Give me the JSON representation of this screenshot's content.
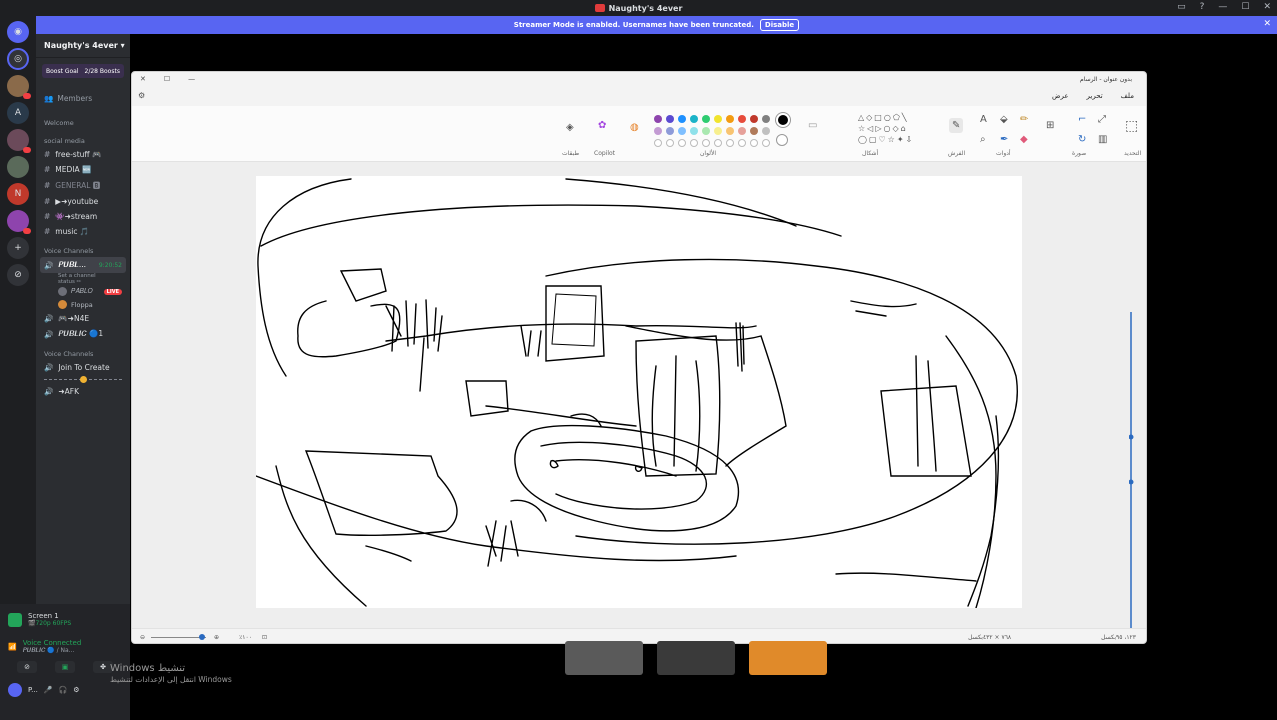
{
  "window": {
    "title": "Naughty's 4ever"
  },
  "banner": {
    "text": "Streamer Mode is enabled. Usernames have been truncated.",
    "button": "Disable"
  },
  "guild": {
    "name": "Naughty's 4ever",
    "boost_label": "Boost Goal",
    "boost_count": "2/28 Boosts",
    "members": "Members",
    "welcome": "Welcome",
    "social_media": "social media",
    "text_channels": [
      "free-stuff 🎮",
      "MEDIA 🆕",
      "GENERAL 🅱",
      "▶➜youtube",
      "👾➜stream",
      "music 🎵"
    ],
    "voice_category": "Voice Channels",
    "active_voice": "𝑷𝑼𝑩𝑳...",
    "active_timer": "9:20:52",
    "channel_status": "Set a channel status ✏",
    "voice_users": [
      {
        "name": "𝑃𝐴𝐵𝐿𝑂",
        "live": "LIVE"
      },
      {
        "name": "Floppa",
        "live": ""
      }
    ],
    "other_voice": [
      "🎮➜N4E",
      "𝑷𝑼𝑩𝑳𝑰𝑪 🔵1"
    ],
    "voice_category2": "Voice Channels",
    "join_create": "Join To Create",
    "afk": "➜AFK"
  },
  "panel": {
    "screen": "Screen 1",
    "screen_sub": "🎬720p 60FPS",
    "voice_connected": "Voice Connected",
    "voice_sub": "𝑷𝑼𝑩𝑳𝑰𝑪 🔵 / Na...",
    "user": "P..."
  },
  "activate": {
    "line1": "Windows تنشيط",
    "line2": "انتقل إلى الإعدادات لتنشيط Windows"
  },
  "paint": {
    "title": "بدون عنوان - الرسام",
    "menu": [
      "ملف",
      "تحرير",
      "عرض"
    ],
    "sections": {
      "layers": "طبقات",
      "copilot": "Copilot",
      "colors": "الألوان",
      "shapes": "أشكال",
      "brushes": "الفرش",
      "tools": "أدوات",
      "image": "صورة",
      "selection": "التحديد"
    },
    "zoom": "٪١٠٠",
    "status_size": "٧٦٨ × ٤٣٢بكسل",
    "status_pos": "١٢٣، ٩٥بكسل"
  },
  "colors": {
    "palette_row1": [
      "#8e44ad",
      "#5b4bd1",
      "#1e90ff",
      "#1bb3c8",
      "#2ecc71",
      "#f1e42e",
      "#f39c12",
      "#e74c3c",
      "#c0392b",
      "#808080",
      "#000000"
    ],
    "palette_row2": [
      "#c39bd3",
      "#8e9bd9",
      "#7fbfff",
      "#8fe1ea",
      "#a9e8b0",
      "#f7ef8e",
      "#f8c471",
      "#e6a19a",
      "#b07a5a",
      "#c0c0c0",
      "#ffffff"
    ]
  }
}
